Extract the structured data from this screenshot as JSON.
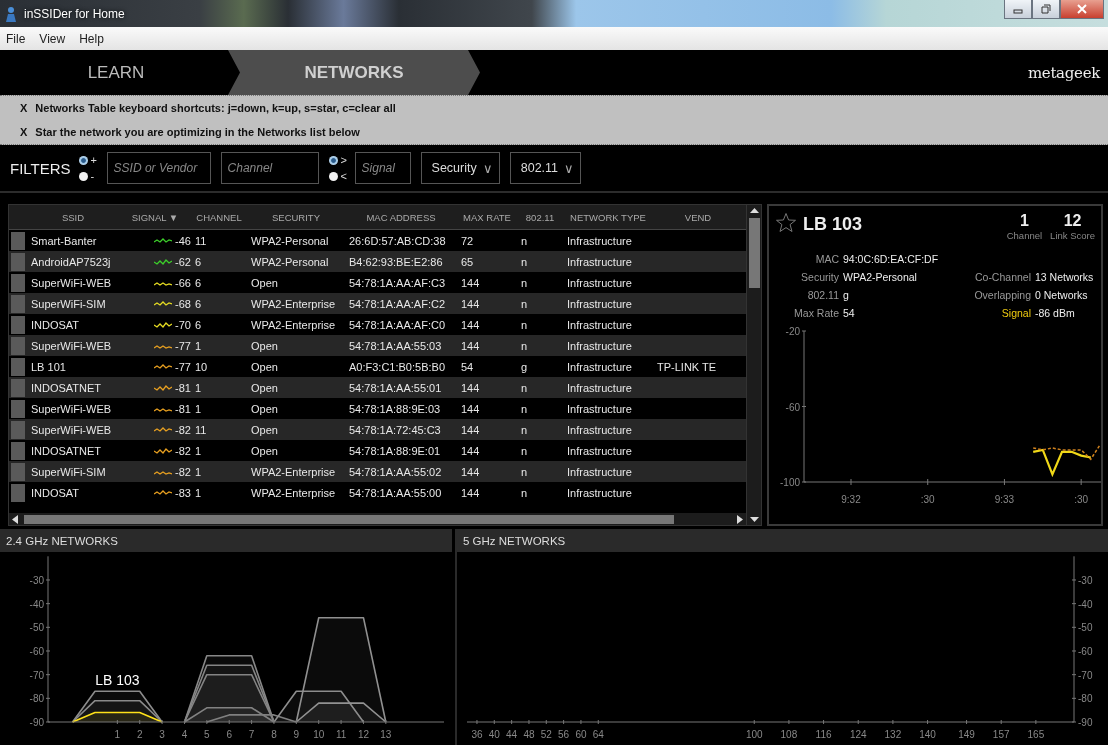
{
  "window": {
    "title": "inSSIDer for Home"
  },
  "menu": [
    "File",
    "View",
    "Help"
  ],
  "nav": {
    "tabs": [
      {
        "label": "LEARN",
        "selected": false
      },
      {
        "label": "NETWORKS",
        "selected": true
      }
    ],
    "logo": "metageek"
  },
  "tips": [
    {
      "close": "X",
      "text": "Networks Table keyboard shortcuts: j=down, k=up, s=star, c=clear all"
    },
    {
      "close": "X",
      "text": "Star the network you are optimizing in the Networks list below"
    }
  ],
  "filters": {
    "label": "FILTERS",
    "include": [
      {
        "label": "+",
        "selected": true
      },
      {
        "label": "-",
        "selected": false
      }
    ],
    "ssid": {
      "placeholder": "SSID or Vendor"
    },
    "channel": {
      "placeholder": "Channel"
    },
    "compare": [
      {
        "label": ">",
        "selected": true
      },
      {
        "label": "<",
        "selected": false
      }
    ],
    "signal": {
      "placeholder": "Signal"
    },
    "dropdowns": [
      {
        "label": "Security",
        "caret": "∨"
      },
      {
        "label": "802.11",
        "caret": "∨"
      }
    ]
  },
  "table": {
    "columns": [
      "SSID",
      "SIGNAL ▼",
      "CHANNEL",
      "SECURITY",
      "MAC ADDRESS",
      "MAX RATE",
      "802.11",
      "NETWORK TYPE",
      "VEND"
    ],
    "rows": [
      {
        "ssid": "Smart-Banter",
        "signal": "-46",
        "color": "#3ccf2a",
        "channel": "11",
        "security": "WPA2-Personal",
        "mac": "26:6D:57:AB:CD:38",
        "max_rate": "72",
        "phy": "n",
        "type": "Infrastructure"
      },
      {
        "ssid": "AndroidAP7523j",
        "signal": "-62",
        "color": "#3ccf2a",
        "channel": "6",
        "security": "WPA2-Personal",
        "mac": "B4:62:93:BE:E2:86",
        "max_rate": "65",
        "phy": "n",
        "type": "Infrastructure"
      },
      {
        "ssid": "SuperWiFi-WEB",
        "signal": "-66",
        "color": "#e6dc22",
        "channel": "6",
        "security": "Open",
        "mac": "54:78:1A:AA:AF:C3",
        "max_rate": "144",
        "phy": "n",
        "type": "Infrastructure"
      },
      {
        "ssid": "SuperWiFi-SIM",
        "signal": "-68",
        "color": "#e6dc22",
        "channel": "6",
        "security": "WPA2-Enterprise",
        "mac": "54:78:1A:AA:AF:C2",
        "max_rate": "144",
        "phy": "n",
        "type": "Infrastructure"
      },
      {
        "ssid": "INDOSAT",
        "signal": "-70",
        "color": "#e6dc22",
        "channel": "6",
        "security": "WPA2-Enterprise",
        "mac": "54:78:1A:AA:AF:C0",
        "max_rate": "144",
        "phy": "n",
        "type": "Infrastructure"
      },
      {
        "ssid": "SuperWiFi-WEB",
        "signal": "-77",
        "color": "#e8a020",
        "channel": "1",
        "security": "Open",
        "mac": "54:78:1A:AA:55:03",
        "max_rate": "144",
        "phy": "n",
        "type": "Infrastructure"
      },
      {
        "ssid": "LB 101",
        "signal": "-77",
        "color": "#e8a020",
        "channel": "10",
        "security": "Open",
        "mac": "A0:F3:C1:B0:5B:B0",
        "max_rate": "54",
        "phy": "g",
        "type": "Infrastructure",
        "vendor": "TP-LINK TE"
      },
      {
        "ssid": "INDOSATNET",
        "signal": "-81",
        "color": "#e8a020",
        "channel": "1",
        "security": "Open",
        "mac": "54:78:1A:AA:55:01",
        "max_rate": "144",
        "phy": "n",
        "type": "Infrastructure"
      },
      {
        "ssid": "SuperWiFi-WEB",
        "signal": "-81",
        "color": "#e8a020",
        "channel": "1",
        "security": "Open",
        "mac": "54:78:1A:88:9E:03",
        "max_rate": "144",
        "phy": "n",
        "type": "Infrastructure"
      },
      {
        "ssid": "SuperWiFi-WEB",
        "signal": "-82",
        "color": "#e8a020",
        "channel": "11",
        "security": "Open",
        "mac": "54:78:1A:72:45:C3",
        "max_rate": "144",
        "phy": "n",
        "type": "Infrastructure"
      },
      {
        "ssid": "INDOSATNET",
        "signal": "-82",
        "color": "#e8a020",
        "channel": "1",
        "security": "Open",
        "mac": "54:78:1A:88:9E:01",
        "max_rate": "144",
        "phy": "n",
        "type": "Infrastructure"
      },
      {
        "ssid": "SuperWiFi-SIM",
        "signal": "-82",
        "color": "#e8a020",
        "channel": "1",
        "security": "WPA2-Enterprise",
        "mac": "54:78:1A:AA:55:02",
        "max_rate": "144",
        "phy": "n",
        "type": "Infrastructure"
      },
      {
        "ssid": "INDOSAT",
        "signal": "-83",
        "color": "#e8a020",
        "channel": "1",
        "security": "WPA2-Enterprise",
        "mac": "54:78:1A:AA:55:00",
        "max_rate": "144",
        "phy": "n",
        "type": "Infrastructure"
      }
    ]
  },
  "details": {
    "name": "LB 103",
    "starred": false,
    "stats": [
      {
        "value": "1",
        "label": "Channel"
      },
      {
        "value": "12",
        "label": "Link Score"
      }
    ],
    "left": [
      {
        "label": "MAC",
        "value": "94:0C:6D:EA:CF:DF"
      },
      {
        "label": "Security",
        "value": "WPA2-Personal"
      },
      {
        "label": "802.11",
        "value": "g"
      },
      {
        "label": "Max Rate",
        "value": "54"
      }
    ],
    "right": [
      {
        "label": "Co-Channel",
        "value": "13 Networks",
        "highlighted": false
      },
      {
        "label": "Overlapping",
        "value": "0 Networks",
        "highlighted": false
      },
      {
        "label": "Signal",
        "value": "-86 dBm",
        "highlighted": true
      }
    ],
    "chart_data": {
      "type": "line",
      "categories": [
        "9:32",
        null,
        null,
        null,
        null,
        null,
        null,
        null,
        ":30",
        null,
        null,
        null,
        null,
        null,
        null,
        null,
        "9:33",
        null,
        null,
        null,
        null,
        null,
        null,
        null,
        ":30",
        null,
        null
      ],
      "ylim": [
        -100,
        -20
      ],
      "yticks": [
        -20,
        -60,
        -100
      ],
      "series": [
        {
          "color": "#f0d818",
          "line_style": "solid",
          "values": [
            null,
            null,
            null,
            null,
            null,
            null,
            null,
            null,
            null,
            null,
            null,
            null,
            null,
            null,
            null,
            null,
            null,
            null,
            null,
            -84,
            -83,
            -96,
            -84,
            -84,
            -86,
            -87,
            null
          ]
        },
        {
          "color": "#d0821e",
          "line_style": "dashed",
          "values": [
            null,
            null,
            null,
            null,
            null,
            null,
            null,
            null,
            null,
            null,
            null,
            null,
            null,
            null,
            null,
            null,
            null,
            null,
            null,
            -82,
            -83,
            -82,
            -83,
            -83,
            -83,
            -88,
            -80
          ]
        }
      ]
    }
  },
  "band_24": {
    "title": "2.4 GHz NETWORKS",
    "chart_data": {
      "type": "area",
      "x": [
        -1,
        0,
        1,
        2,
        3,
        4,
        5,
        6,
        7,
        8,
        9,
        10,
        11,
        12,
        13
      ],
      "xlim": [
        -2.1,
        15.6
      ],
      "ylim": [
        -90,
        -20
      ],
      "xticks": [
        1,
        2,
        3,
        4,
        5,
        6,
        7,
        8,
        9,
        10,
        11,
        12,
        13
      ],
      "yticks": [
        -30,
        -40,
        -50,
        -60,
        -70,
        -80,
        -90
      ],
      "series": [
        {
          "color": "#8c8c8c",
          "values": [
            -90,
            -77,
            -77,
            -77,
            -90,
            null,
            null,
            null,
            null,
            null,
            null,
            null,
            null,
            null,
            null
          ]
        },
        {
          "color": "#8a8a8a",
          "values": [
            -90,
            -81,
            -81,
            -81,
            -90,
            null,
            null,
            null,
            null,
            null,
            null,
            null,
            null,
            null,
            null
          ]
        },
        {
          "color": "#888888",
          "values": [
            null,
            null,
            null,
            null,
            null,
            -90,
            -62,
            -62,
            -62,
            -90,
            null,
            null,
            null,
            null,
            null
          ]
        },
        {
          "color": "#868686",
          "values": [
            null,
            null,
            null,
            null,
            null,
            -90,
            -66,
            -66,
            -66,
            -90,
            null,
            null,
            null,
            null,
            null
          ]
        },
        {
          "color": "#848484",
          "values": [
            null,
            null,
            null,
            null,
            null,
            -90,
            -70,
            -70,
            -70,
            -90,
            null,
            null,
            null,
            null,
            null
          ]
        },
        {
          "color": "#828282",
          "values": [
            null,
            null,
            null,
            null,
            null,
            -90,
            -84,
            -84,
            -84,
            -90,
            null,
            null,
            null,
            null,
            null
          ]
        },
        {
          "color": "#808080",
          "values": [
            null,
            null,
            null,
            null,
            null,
            null,
            -90,
            -87,
            -87,
            -87,
            -90,
            null,
            null,
            null,
            null
          ]
        },
        {
          "color": "#8e8e8e",
          "values": [
            null,
            null,
            null,
            null,
            null,
            null,
            null,
            null,
            null,
            -90,
            -77,
            -77,
            -77,
            -90,
            null
          ]
        },
        {
          "color": "#909090",
          "values": [
            null,
            null,
            null,
            null,
            null,
            null,
            null,
            null,
            null,
            null,
            -90,
            -46,
            -46,
            -46,
            -90
          ]
        },
        {
          "color": "#929292",
          "values": [
            null,
            null,
            null,
            null,
            null,
            null,
            null,
            null,
            null,
            null,
            -90,
            -82,
            -82,
            -82,
            -90
          ]
        },
        {
          "color": "#ffe21a",
          "values": [
            -90,
            -86,
            -86,
            -86,
            -90,
            null,
            null,
            null,
            null,
            null,
            null,
            null,
            null,
            null,
            null
          ]
        }
      ],
      "annotations": [
        "LB 103"
      ]
    }
  },
  "band_5": {
    "title": "5 GHz NETWORKS",
    "chart_data": {
      "type": "area",
      "xlim": [
        33.7,
        173.8
      ],
      "ylim": [
        -90,
        -20
      ],
      "xticks": [
        36,
        40,
        44,
        48,
        52,
        56,
        60,
        64,
        100,
        108,
        116,
        124,
        132,
        140,
        149,
        157,
        165
      ],
      "yticks": [
        -30,
        -40,
        -50,
        -60,
        -70,
        -80,
        -90
      ]
    }
  }
}
